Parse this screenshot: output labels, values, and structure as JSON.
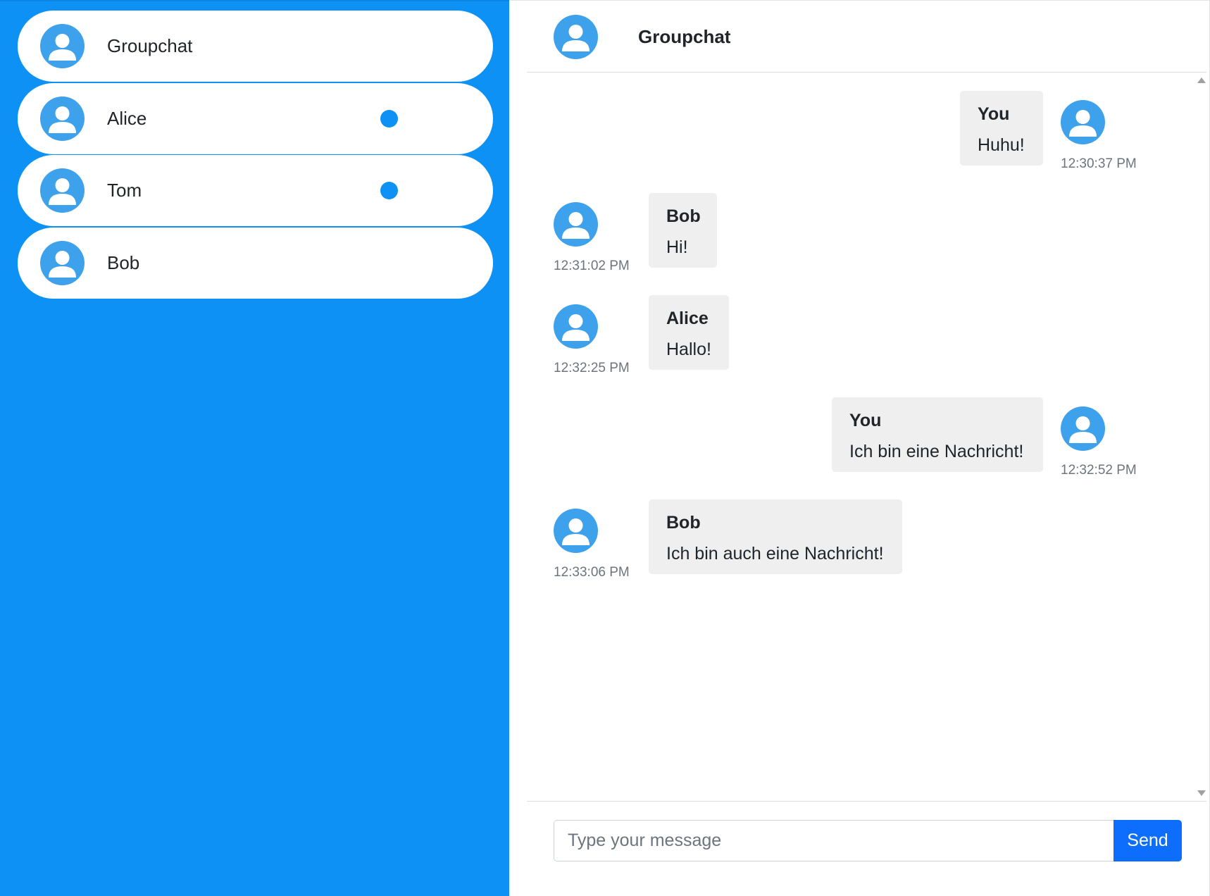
{
  "sidebar": {
    "contacts": [
      {
        "name": "Groupchat",
        "unread": false
      },
      {
        "name": "Alice",
        "unread": true
      },
      {
        "name": "Tom",
        "unread": true
      },
      {
        "name": "Bob",
        "unread": false
      }
    ]
  },
  "chat": {
    "title": "Groupchat",
    "messages": [
      {
        "sender": "You",
        "text": "Huhu!",
        "time": "12:30:37 PM",
        "own": true
      },
      {
        "sender": "Bob",
        "text": "Hi!",
        "time": "12:31:02 PM",
        "own": false
      },
      {
        "sender": "Alice",
        "text": "Hallo!",
        "time": "12:32:25 PM",
        "own": false
      },
      {
        "sender": "You",
        "text": "Ich bin eine Nachricht!",
        "time": "12:32:52 PM",
        "own": true
      },
      {
        "sender": "Bob",
        "text": "Ich bin auch eine Nachricht!",
        "time": "12:33:06 PM",
        "own": false
      }
    ]
  },
  "composer": {
    "placeholder": "Type your message",
    "value": "",
    "send_label": "Send"
  },
  "colors": {
    "sidebar_bg": "#0d91f5",
    "avatar_bg": "#3ea1ec",
    "send_button": "#0d6efd",
    "bubble_bg": "#efefef"
  },
  "icons": {
    "avatar": "user-avatar-icon",
    "unread": "unread-dot-icon"
  }
}
